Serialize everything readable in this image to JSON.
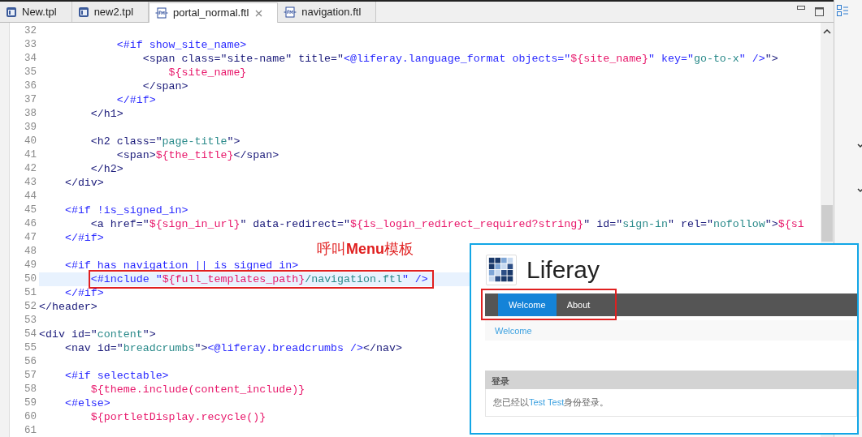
{
  "tabs": [
    {
      "label": "New.tpl",
      "kind": "tpl",
      "selected": false
    },
    {
      "label": "new2.tpl",
      "kind": "tpl",
      "selected": false
    },
    {
      "label": "portal_normal.ftl",
      "kind": "ftl",
      "selected": true
    },
    {
      "label": "navigation.ftl",
      "kind": "ftl",
      "selected": false
    }
  ],
  "code": {
    "lines": [
      {
        "number": "32",
        "highlighted": false,
        "boxed": false
      },
      {
        "number": "33",
        "highlighted": false,
        "boxed": false,
        "segments": [
          {
            "kind": "ftl",
            "text": "            <#if show_site_name>"
          }
        ]
      },
      {
        "number": "34",
        "highlighted": false,
        "boxed": false,
        "segments": [
          {
            "kind": "tag",
            "text": "                <span class=\"site-name\" title=\""
          },
          {
            "kind": "ftl",
            "text": "<@liferay.language_format objects=\""
          },
          {
            "kind": "expr",
            "text": "${site_name}"
          },
          {
            "kind": "ftl",
            "text": "\" key=\""
          },
          {
            "kind": "str",
            "text": "go-to-x"
          },
          {
            "kind": "ftl",
            "text": "\" />"
          },
          {
            "kind": "tag",
            "text": "\">"
          }
        ]
      },
      {
        "number": "35",
        "highlighted": false,
        "boxed": false,
        "segments": [
          {
            "kind": "expr",
            "text": "                    ${site_name}"
          }
        ]
      },
      {
        "number": "36",
        "highlighted": false,
        "boxed": false,
        "segments": [
          {
            "kind": "tag",
            "text": "                </span>"
          }
        ]
      },
      {
        "number": "37",
        "highlighted": false,
        "boxed": false,
        "segments": [
          {
            "kind": "ftl",
            "text": "            </#if>"
          }
        ]
      },
      {
        "number": "38",
        "highlighted": false,
        "boxed": false,
        "segments": [
          {
            "kind": "tag",
            "text": "        </h1>"
          }
        ]
      },
      {
        "number": "39",
        "highlighted": false,
        "boxed": false
      },
      {
        "number": "40",
        "highlighted": false,
        "boxed": false,
        "segments": [
          {
            "kind": "tag",
            "text": "        <h2 class=\""
          },
          {
            "kind": "str",
            "text": "page-title"
          },
          {
            "kind": "tag",
            "text": "\">"
          }
        ]
      },
      {
        "number": "41",
        "highlighted": false,
        "boxed": false,
        "segments": [
          {
            "kind": "tag",
            "text": "            <span>"
          },
          {
            "kind": "expr",
            "text": "${the_title}"
          },
          {
            "kind": "tag",
            "text": "</span>"
          }
        ]
      },
      {
        "number": "42",
        "highlighted": false,
        "boxed": false,
        "segments": [
          {
            "kind": "tag",
            "text": "        </h2>"
          }
        ]
      },
      {
        "number": "43",
        "highlighted": false,
        "boxed": false,
        "segments": [
          {
            "kind": "tag",
            "text": "    </div>"
          }
        ]
      },
      {
        "number": "44",
        "highlighted": false,
        "boxed": false
      },
      {
        "number": "45",
        "highlighted": false,
        "boxed": false,
        "segments": [
          {
            "kind": "ftl",
            "text": "    <#if !is_signed_in>"
          }
        ]
      },
      {
        "number": "46",
        "highlighted": false,
        "boxed": false,
        "segments": [
          {
            "kind": "tag",
            "text": "        <a href=\""
          },
          {
            "kind": "expr",
            "text": "${sign_in_url}"
          },
          {
            "kind": "tag",
            "text": "\" data-redirect=\""
          },
          {
            "kind": "expr",
            "text": "${is_login_redirect_required?string}"
          },
          {
            "kind": "tag",
            "text": "\" id=\""
          },
          {
            "kind": "str",
            "text": "sign-in"
          },
          {
            "kind": "tag",
            "text": "\" rel=\""
          },
          {
            "kind": "str",
            "text": "nofollow"
          },
          {
            "kind": "tag",
            "text": "\">"
          },
          {
            "kind": "expr",
            "text": "${si"
          }
        ]
      },
      {
        "number": "47",
        "highlighted": false,
        "boxed": false,
        "segments": [
          {
            "kind": "ftl",
            "text": "    </#if>"
          }
        ]
      },
      {
        "number": "48",
        "highlighted": false,
        "boxed": false
      },
      {
        "number": "49",
        "highlighted": false,
        "boxed": false,
        "segments": [
          {
            "kind": "ftl",
            "text": "    <#if has navigation || is signed in>"
          }
        ]
      },
      {
        "number": "50",
        "highlighted": true,
        "boxed": true,
        "segments": [
          {
            "kind": "ftl",
            "text": "        <#include \""
          },
          {
            "kind": "expr",
            "text": "${full_templates_path}"
          },
          {
            "kind": "str",
            "text": "/navigation.ftl"
          },
          {
            "kind": "ftl",
            "text": "\" />"
          }
        ]
      },
      {
        "number": "51",
        "highlighted": false,
        "boxed": false,
        "segments": [
          {
            "kind": "ftl",
            "text": "    </#if>"
          }
        ]
      },
      {
        "number": "52",
        "highlighted": false,
        "boxed": false,
        "segments": [
          {
            "kind": "tag",
            "text": "</header>"
          }
        ]
      },
      {
        "number": "53",
        "highlighted": false,
        "boxed": false
      },
      {
        "number": "54",
        "highlighted": false,
        "boxed": false,
        "segments": [
          {
            "kind": "tag",
            "text": "<div id=\""
          },
          {
            "kind": "str",
            "text": "content"
          },
          {
            "kind": "tag",
            "text": "\">"
          }
        ]
      },
      {
        "number": "55",
        "highlighted": false,
        "boxed": false,
        "segments": [
          {
            "kind": "tag",
            "text": "    <nav id=\""
          },
          {
            "kind": "str",
            "text": "breadcrumbs"
          },
          {
            "kind": "tag",
            "text": "\">"
          },
          {
            "kind": "ftl",
            "text": "<@liferay.breadcrumbs />"
          },
          {
            "kind": "tag",
            "text": "</nav>"
          }
        ]
      },
      {
        "number": "56",
        "highlighted": false,
        "boxed": false
      },
      {
        "number": "57",
        "highlighted": false,
        "boxed": false,
        "segments": [
          {
            "kind": "ftl",
            "text": "    <#if selectable>"
          }
        ]
      },
      {
        "number": "58",
        "highlighted": false,
        "boxed": false,
        "segments": [
          {
            "kind": "expr",
            "text": "        ${theme.include(content_include)}"
          }
        ]
      },
      {
        "number": "59",
        "highlighted": false,
        "boxed": false,
        "segments": [
          {
            "kind": "ftl",
            "text": "    <#else>"
          }
        ]
      },
      {
        "number": "60",
        "highlighted": false,
        "boxed": false,
        "segments": [
          {
            "kind": "expr",
            "text": "        ${portletDisplay.recycle()}"
          }
        ]
      },
      {
        "number": "61",
        "highlighted": false,
        "boxed": false
      }
    ]
  },
  "annotation": "呼叫**Menu**模板",
  "preview": {
    "site_name": "Liferay",
    "nav_boxed": true,
    "nav": [
      {
        "label": "Welcome",
        "selected": true
      },
      {
        "label": "About",
        "selected": false
      }
    ],
    "breadcrumb": "Welcome",
    "portlet": {
      "title": "登录",
      "message_before": "您已经以",
      "user_link": "Test Test",
      "message_after": "身份登录。"
    }
  }
}
